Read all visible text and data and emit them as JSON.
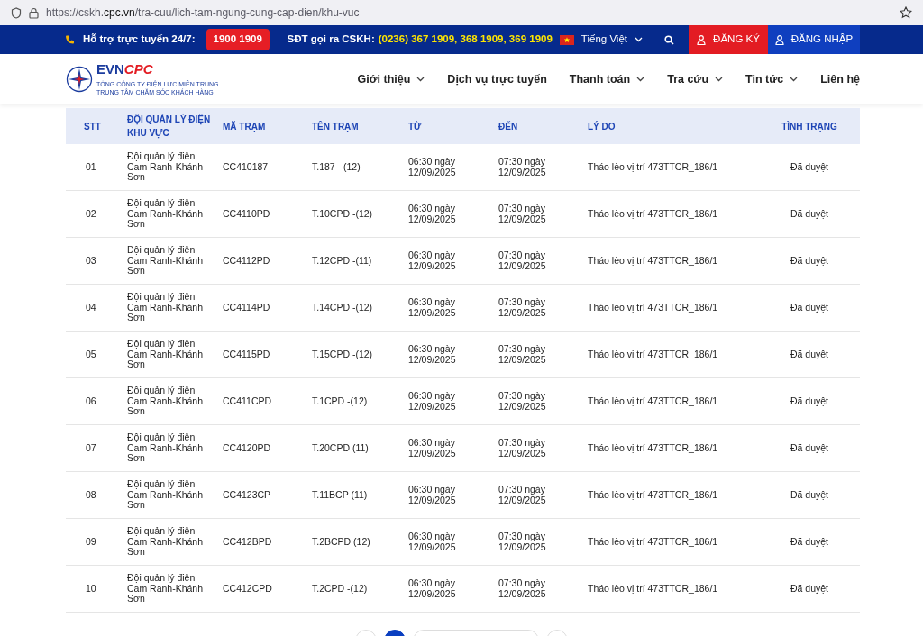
{
  "browser": {
    "url_prefix": "https://cskh.",
    "url_domain": "cpc.vn",
    "url_path": "/tra-cuu/lich-tam-ngung-cung-cap-dien/khu-vuc"
  },
  "top_bar": {
    "support_label": "Hỗ trợ trực tuyến 24/7:",
    "hotline": "1900 1909",
    "cskh_label": "SĐT gọi ra CSKH:",
    "cskh_numbers": "(0236) 367 1909, 368 1909, 369 1909",
    "language": "Tiếng Việt",
    "register": "ĐĂNG KÝ",
    "login": "ĐĂNG NHẬP"
  },
  "logo": {
    "evn": "EVN",
    "cpc": "CPC",
    "line1": "TỔNG CÔNG TY ĐIỆN LỰC MIỀN TRUNG",
    "line2": "TRUNG TÂM CHĂM SÓC KHÁCH HÀNG"
  },
  "nav": [
    {
      "label": "Giới thiệu",
      "dropdown": true
    },
    {
      "label": "Dịch vụ trực tuyến",
      "dropdown": false
    },
    {
      "label": "Thanh toán",
      "dropdown": true
    },
    {
      "label": "Tra cứu",
      "dropdown": true
    },
    {
      "label": "Tin tức",
      "dropdown": true
    },
    {
      "label": "Liên hệ",
      "dropdown": false
    }
  ],
  "table": {
    "columns": [
      "STT",
      "ĐỘI QUẢN LÝ ĐIỆN KHU VỰC",
      "MÃ TRẠM",
      "TÊN TRẠM",
      "TỪ",
      "ĐẾN",
      "LÝ DO",
      "TÌNH TRẠNG"
    ],
    "rows": [
      [
        "01",
        "Đội quản lý điện Cam Ranh-Khánh Sơn",
        "CC410187",
        "T.187 - (12)",
        "06:30 ngày 12/09/2025",
        "07:30 ngày 12/09/2025",
        "Tháo lèo vị trí 473TTCR_186/1",
        "Đã duyệt"
      ],
      [
        "02",
        "Đội quản lý điện Cam Ranh-Khánh Sơn",
        "CC4110PD",
        "T.10CPD -(12)",
        "06:30 ngày 12/09/2025",
        "07:30 ngày 12/09/2025",
        "Tháo lèo vị trí 473TTCR_186/1",
        "Đã duyệt"
      ],
      [
        "03",
        "Đội quản lý điện Cam Ranh-Khánh Sơn",
        "CC4112PD",
        "T.12CPD -(11)",
        "06:30 ngày 12/09/2025",
        "07:30 ngày 12/09/2025",
        "Tháo lèo vị trí 473TTCR_186/1",
        "Đã duyệt"
      ],
      [
        "04",
        "Đội quản lý điện Cam Ranh-Khánh Sơn",
        "CC4114PD",
        "T.14CPD -(12)",
        "06:30 ngày 12/09/2025",
        "07:30 ngày 12/09/2025",
        "Tháo lèo vị trí 473TTCR_186/1",
        "Đã duyệt"
      ],
      [
        "05",
        "Đội quản lý điện Cam Ranh-Khánh Sơn",
        "CC4115PD",
        "T.15CPD -(12)",
        "06:30 ngày 12/09/2025",
        "07:30 ngày 12/09/2025",
        "Tháo lèo vị trí 473TTCR_186/1",
        "Đã duyệt"
      ],
      [
        "06",
        "Đội quản lý điện Cam Ranh-Khánh Sơn",
        "CC411CPD",
        "T.1CPD -(12)",
        "06:30 ngày 12/09/2025",
        "07:30 ngày 12/09/2025",
        "Tháo lèo vị trí 473TTCR_186/1",
        "Đã duyệt"
      ],
      [
        "07",
        "Đội quản lý điện Cam Ranh-Khánh Sơn",
        "CC4120PD",
        "T.20CPD (11)",
        "06:30 ngày 12/09/2025",
        "07:30 ngày 12/09/2025",
        "Tháo lèo vị trí 473TTCR_186/1",
        "Đã duyệt"
      ],
      [
        "08",
        "Đội quản lý điện Cam Ranh-Khánh Sơn",
        "CC4123CP",
        "T.11BCP (11)",
        "06:30 ngày 12/09/2025",
        "07:30 ngày 12/09/2025",
        "Tháo lèo vị trí 473TTCR_186/1",
        "Đã duyệt"
      ],
      [
        "09",
        "Đội quản lý điện Cam Ranh-Khánh Sơn",
        "CC412BPD",
        "T.2BCPD (12)",
        "06:30 ngày 12/09/2025",
        "07:30 ngày 12/09/2025",
        "Tháo lèo vị trí 473TTCR_186/1",
        "Đã duyệt"
      ],
      [
        "10",
        "Đội quản lý điện Cam Ranh-Khánh Sơn",
        "CC412CPD",
        "T.2CPD -(12)",
        "06:30 ngày 12/09/2025",
        "07:30 ngày 12/09/2025",
        "Tháo lèo vị trí 473TTCR_186/1",
        "Đã duyệt"
      ]
    ]
  },
  "pagination": [
    {
      "kind": "prev",
      "selected": false
    },
    {
      "kind": "page",
      "selected": true
    },
    {
      "kind": "pages",
      "selected": false
    },
    {
      "kind": "next",
      "selected": false
    }
  ]
}
